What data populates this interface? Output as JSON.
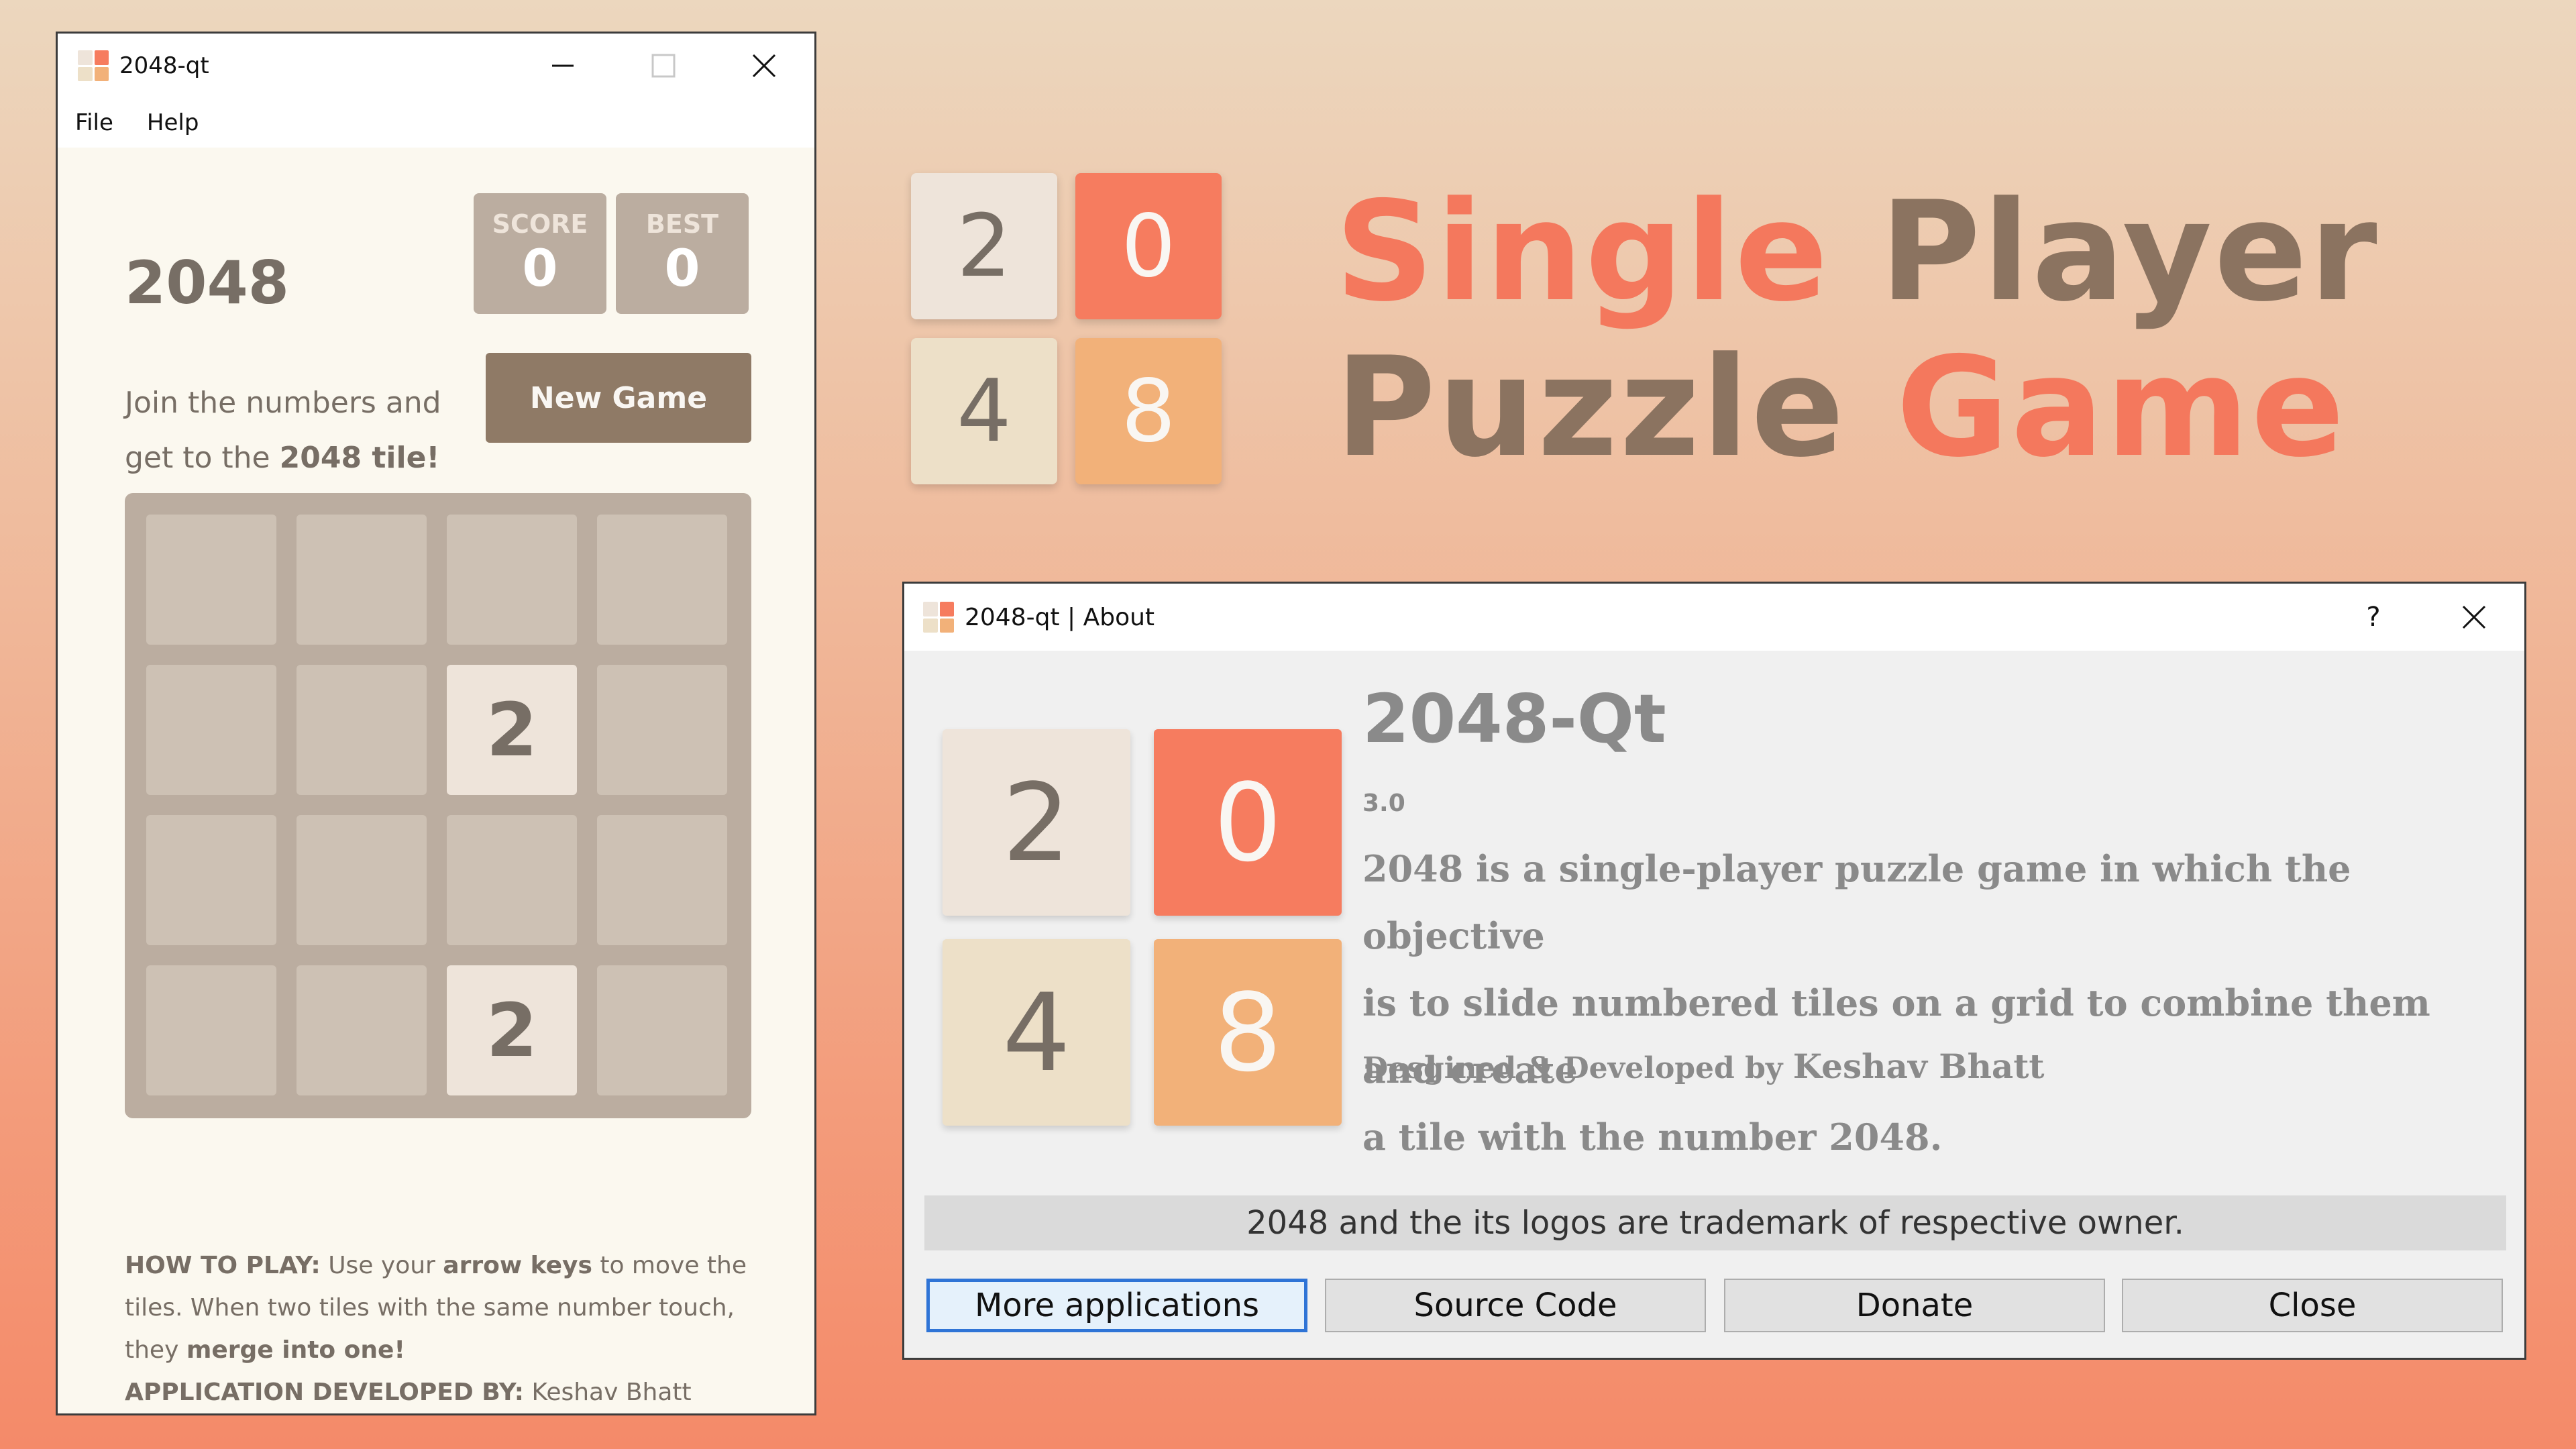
{
  "game_window": {
    "title": "2048-qt",
    "menu": [
      "File",
      "Help"
    ],
    "brand": "2048",
    "score_label": "SCORE",
    "score_value": "0",
    "best_label": "BEST",
    "best_value": "0",
    "intro_line1": "Join the numbers and",
    "intro_line2_prefix": "get to the ",
    "intro_line2_bold": "2048 tile!",
    "new_game_label": "New Game",
    "board": [
      [
        "",
        "",
        "",
        ""
      ],
      [
        "",
        "",
        "2",
        ""
      ],
      [
        "",
        "",
        "",
        ""
      ],
      [
        "",
        "",
        "2",
        ""
      ]
    ],
    "howto": {
      "label": "HOW TO PLAY:",
      "text1": " Use your ",
      "keys": "arrow keys",
      "text2": " to move the tiles. When two tiles with the same number touch, they ",
      "merge": "merge into one!",
      "dev_label": "APPLICATION DEVELOPED BY:",
      "dev_name": " Keshav Bhatt"
    }
  },
  "promo": {
    "tiles": [
      "2",
      "0",
      "4",
      "8"
    ],
    "headline": {
      "word1": "Single",
      "word2": "Player",
      "word3": "Puzzle",
      "word4": "Game"
    }
  },
  "about_dialog": {
    "title": "2048-qt | About",
    "help_glyph": "?",
    "tiles": [
      "2",
      "0",
      "4",
      "8"
    ],
    "app_name": "2048-Qt",
    "version": "3.0",
    "description_lines": [
      "2048 is a single-player puzzle game in which the objective",
      "is to slide numbered tiles on a grid to combine them and create",
      "a tile with the number 2048."
    ],
    "credit_prefix": "Desgined & Developed by ",
    "credit_name": "Keshav Bhatt",
    "trademark": "2048 and the its logos are trademark of respective owner.",
    "buttons": [
      "More applications",
      "Source Code",
      "Donate",
      "Close"
    ]
  },
  "colors": {
    "tile_2": "#eee4da",
    "tile_0": "#f67c5f",
    "tile_4": "#ede0c8",
    "tile_8": "#f2b179",
    "board": "#bbada0",
    "empty_cell": "#cdc1b4",
    "text_brown": "#776e65",
    "headline_orange": "#f4785d",
    "headline_brown": "#8b7360",
    "focus_blue": "#2f74d6"
  },
  "icons": [
    "app-icon",
    "minimize-icon",
    "maximize-icon",
    "close-icon",
    "help-icon"
  ]
}
